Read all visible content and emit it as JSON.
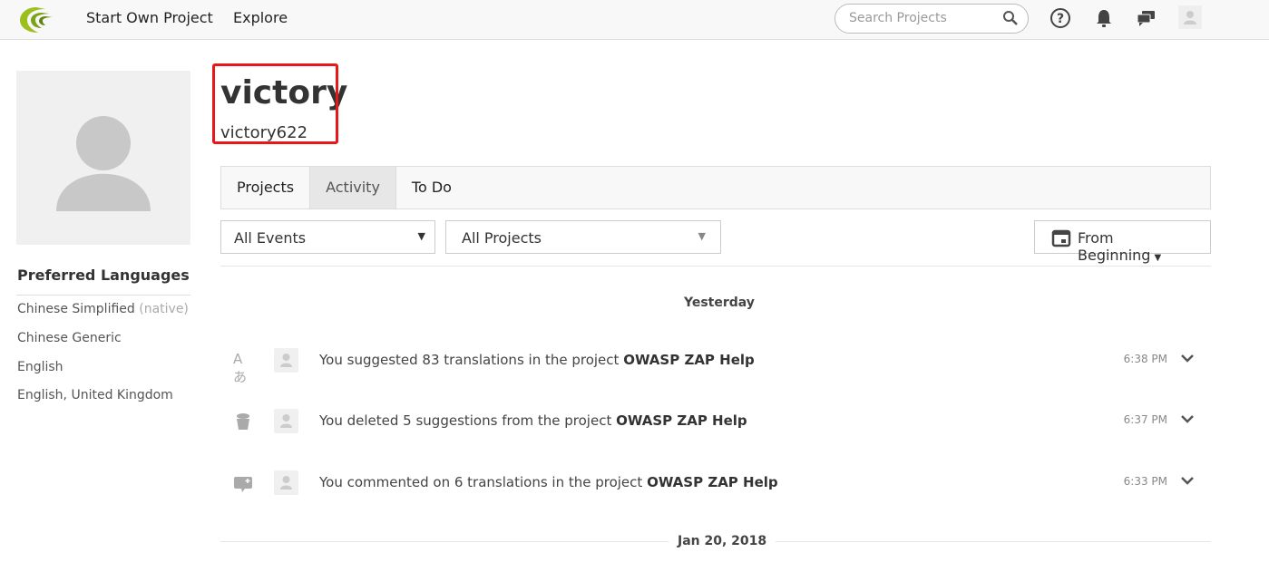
{
  "nav": {
    "links": [
      "Start Own Project",
      "Explore"
    ],
    "search_placeholder": "Search Projects"
  },
  "profile": {
    "name": "victory",
    "username": "victory622"
  },
  "languages": {
    "title": "Preferred Languages",
    "items": [
      {
        "label": "Chinese Simplified",
        "note": "(native)"
      },
      {
        "label": "Chinese Generic"
      },
      {
        "label": "English"
      },
      {
        "label": "English, United Kingdom"
      }
    ]
  },
  "tabs": [
    "Projects",
    "Activity",
    "To Do"
  ],
  "filters": {
    "events": "All Events",
    "projects": "All Projects",
    "date": "From Beginning"
  },
  "days": [
    "Yesterday",
    "Jan 20, 2018"
  ],
  "activity": [
    {
      "icon": "translate-icon",
      "text": "You suggested 83 translations in the project ",
      "project": "OWASP ZAP Help",
      "time": "6:38 PM"
    },
    {
      "icon": "trash-icon",
      "text": "You deleted 5 suggestions from the project ",
      "project": "OWASP ZAP Help",
      "time": "6:37 PM"
    },
    {
      "icon": "comment-add-icon",
      "text": "You commented on 6 translations in the project ",
      "project": "OWASP ZAP Help",
      "time": "6:33 PM"
    }
  ]
}
